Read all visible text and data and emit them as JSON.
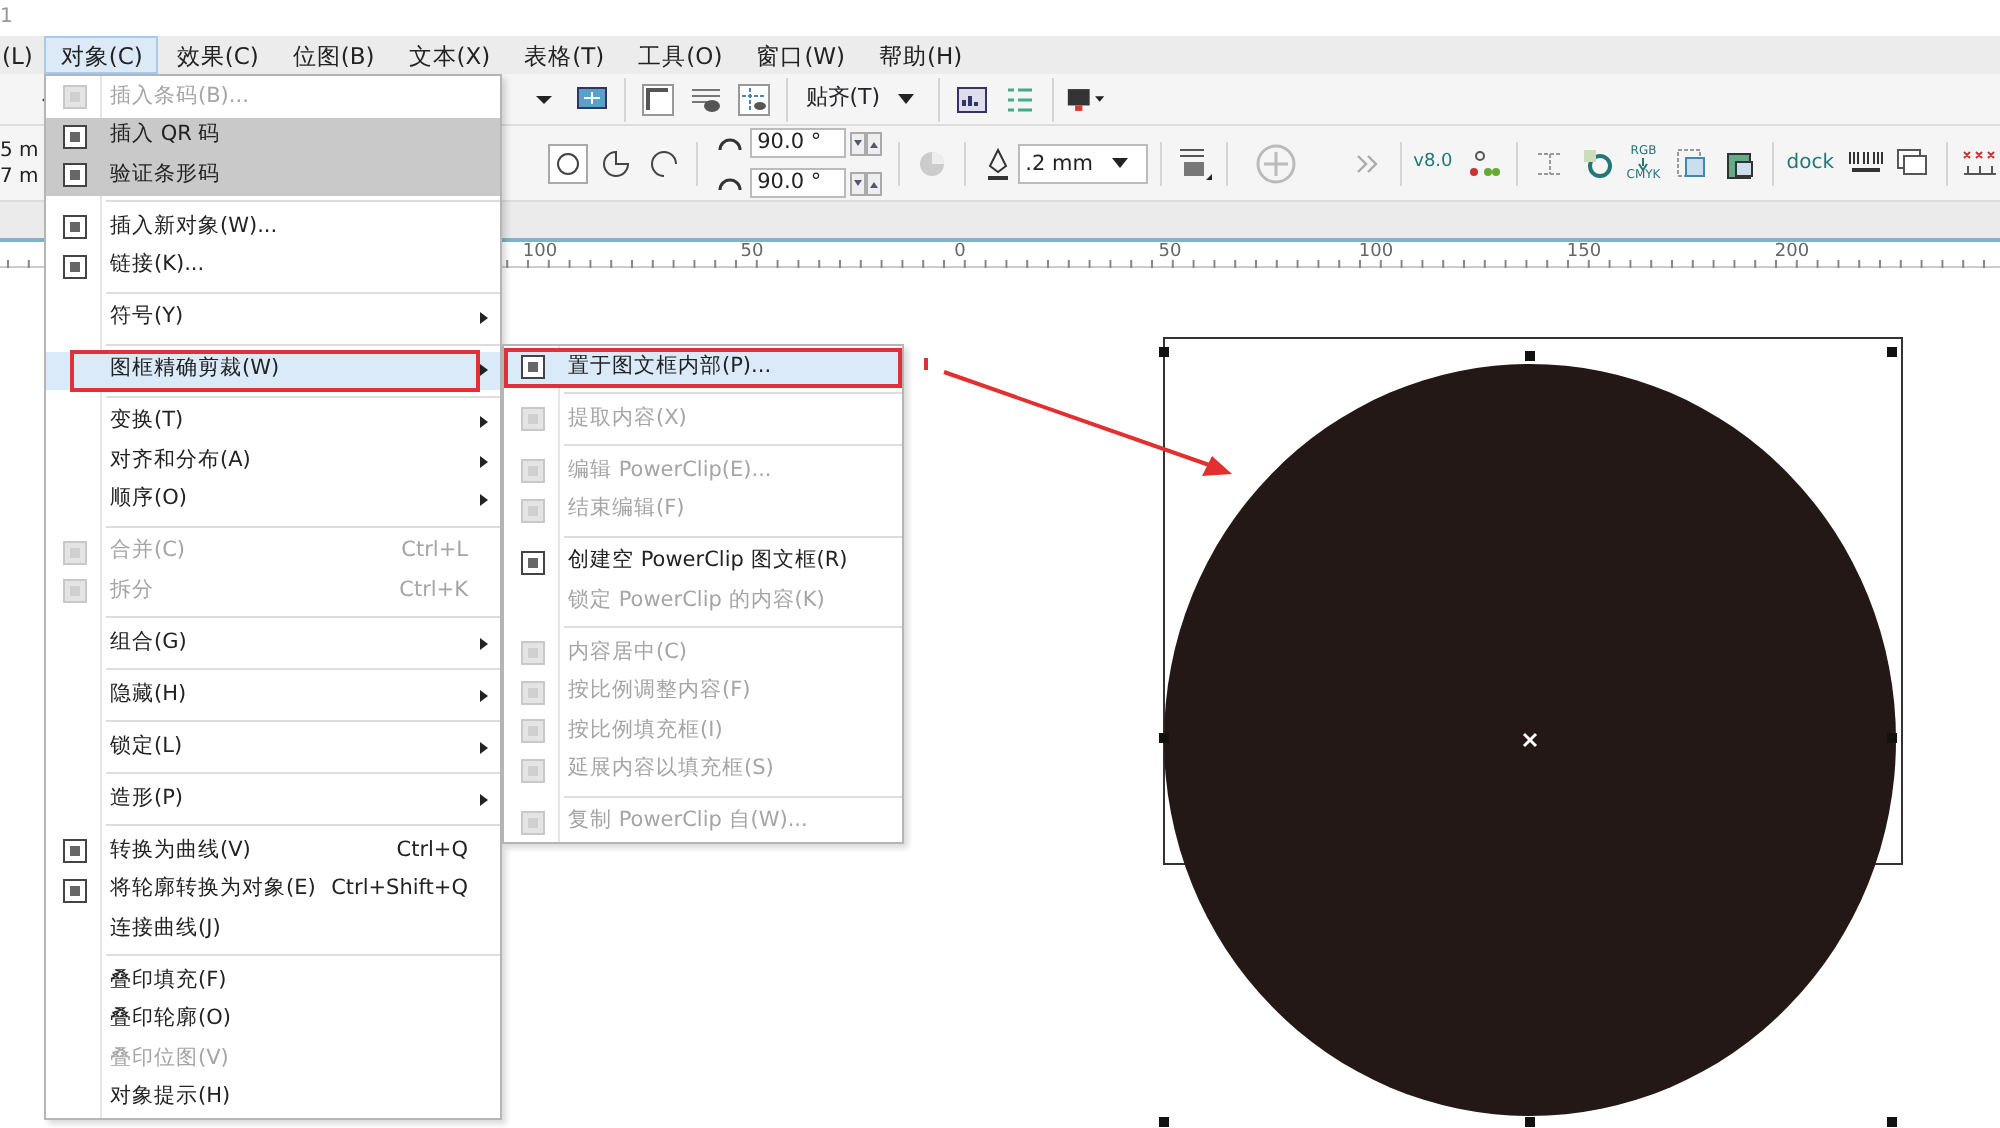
{
  "window": {
    "title": "1"
  },
  "menubar": [
    {
      "label": "(L)",
      "selected": false
    },
    {
      "label": "对象(C)",
      "selected": true
    },
    {
      "label": "效果(C)",
      "selected": false
    },
    {
      "label": "位图(B)",
      "selected": false
    },
    {
      "label": "文本(X)",
      "selected": false
    },
    {
      "label": "表格(T)",
      "selected": false
    },
    {
      "label": "工具(O)",
      "selected": false
    },
    {
      "label": "窗口(W)",
      "selected": false
    },
    {
      "label": "帮助(H)",
      "selected": false
    }
  ],
  "toolbar": {
    "snap_label": "贴齐(T)",
    "size_fields": [
      "5 m",
      "7 m"
    ],
    "angle_fields": [
      "90.0 °",
      "90.0 °"
    ],
    "outline_width": ".2 mm",
    "version_label": "v8.0",
    "rgb_label": "RGB",
    "cmyk_label": "CMYK",
    "dock_label": "dock"
  },
  "ruler": {
    "labels": [
      "100",
      "50",
      "0",
      "50",
      "100",
      "150",
      "200"
    ]
  },
  "menu": [
    {
      "kind": "item",
      "label": "插入条码(B)...",
      "icon": true,
      "disabled": true,
      "shaded": false,
      "selected": false,
      "submenu": false
    },
    {
      "kind": "item",
      "label": "插入 QR 码",
      "icon": true,
      "disabled": false,
      "shaded": true,
      "selected": false,
      "submenu": false
    },
    {
      "kind": "item",
      "label": "验证条形码",
      "icon": true,
      "disabled": false,
      "shaded": true,
      "selected": false,
      "submenu": false
    },
    {
      "kind": "separator"
    },
    {
      "kind": "item",
      "label": "插入新对象(W)...",
      "icon": true,
      "disabled": false,
      "shaded": false,
      "selected": false,
      "submenu": false
    },
    {
      "kind": "item",
      "label": "链接(K)...",
      "icon": true,
      "disabled": false,
      "shaded": false,
      "selected": false,
      "submenu": false
    },
    {
      "kind": "separator"
    },
    {
      "kind": "item",
      "label": "符号(Y)",
      "icon": false,
      "disabled": false,
      "shaded": false,
      "selected": false,
      "submenu": true
    },
    {
      "kind": "separator"
    },
    {
      "kind": "item",
      "label": "图框精确剪裁(W)",
      "icon": false,
      "disabled": false,
      "shaded": false,
      "selected": true,
      "submenu": true,
      "annotated": true
    },
    {
      "kind": "separator"
    },
    {
      "kind": "item",
      "label": "变换(T)",
      "icon": false,
      "disabled": false,
      "shaded": false,
      "selected": false,
      "submenu": true
    },
    {
      "kind": "item",
      "label": "对齐和分布(A)",
      "icon": false,
      "disabled": false,
      "shaded": false,
      "selected": false,
      "submenu": true
    },
    {
      "kind": "item",
      "label": "顺序(O)",
      "icon": false,
      "disabled": false,
      "shaded": false,
      "selected": false,
      "submenu": true
    },
    {
      "kind": "separator"
    },
    {
      "kind": "item",
      "label": "合并(C)",
      "shortcut": "Ctrl+L",
      "icon": true,
      "disabled": true,
      "shaded": false,
      "selected": false,
      "submenu": false
    },
    {
      "kind": "item",
      "label": "拆分",
      "shortcut": "Ctrl+K",
      "icon": true,
      "disabled": true,
      "shaded": false,
      "selected": false,
      "submenu": false
    },
    {
      "kind": "separator"
    },
    {
      "kind": "item",
      "label": "组合(G)",
      "icon": false,
      "disabled": false,
      "shaded": false,
      "selected": false,
      "submenu": true
    },
    {
      "kind": "separator"
    },
    {
      "kind": "item",
      "label": "隐藏(H)",
      "icon": false,
      "disabled": false,
      "shaded": false,
      "selected": false,
      "submenu": true
    },
    {
      "kind": "separator"
    },
    {
      "kind": "item",
      "label": "锁定(L)",
      "icon": false,
      "disabled": false,
      "shaded": false,
      "selected": false,
      "submenu": true
    },
    {
      "kind": "separator"
    },
    {
      "kind": "item",
      "label": "造形(P)",
      "icon": false,
      "disabled": false,
      "shaded": false,
      "selected": false,
      "submenu": true
    },
    {
      "kind": "separator"
    },
    {
      "kind": "item",
      "label": "转换为曲线(V)",
      "shortcut": "Ctrl+Q",
      "icon": true,
      "disabled": false,
      "shaded": false,
      "selected": false,
      "submenu": false
    },
    {
      "kind": "item",
      "label": "将轮廓转换为对象(E)",
      "shortcut": "Ctrl+Shift+Q",
      "icon": true,
      "disabled": false,
      "shaded": false,
      "selected": false,
      "submenu": false
    },
    {
      "kind": "item",
      "label": "连接曲线(J)",
      "icon": false,
      "disabled": false,
      "shaded": false,
      "selected": false,
      "submenu": false
    },
    {
      "kind": "separator"
    },
    {
      "kind": "item",
      "label": "叠印填充(F)",
      "icon": false,
      "disabled": false,
      "shaded": false,
      "selected": false,
      "submenu": false
    },
    {
      "kind": "item",
      "label": "叠印轮廓(O)",
      "icon": false,
      "disabled": false,
      "shaded": false,
      "selected": false,
      "submenu": false
    },
    {
      "kind": "item",
      "label": "叠印位图(V)",
      "icon": false,
      "disabled": true,
      "shaded": false,
      "selected": false,
      "submenu": false
    },
    {
      "kind": "item",
      "label": "对象提示(H)",
      "icon": false,
      "disabled": false,
      "shaded": false,
      "selected": false,
      "submenu": false
    }
  ],
  "submenu": [
    {
      "kind": "item",
      "label": "置于图文框内部(P)...",
      "icon": true,
      "disabled": false,
      "selected": true,
      "annotated": true
    },
    {
      "kind": "separator"
    },
    {
      "kind": "item",
      "label": "提取内容(X)",
      "icon": true,
      "disabled": true,
      "selected": false
    },
    {
      "kind": "separator"
    },
    {
      "kind": "item",
      "label": "编辑 PowerClip(E)...",
      "icon": true,
      "disabled": true,
      "selected": false
    },
    {
      "kind": "item",
      "label": "结束编辑(F)",
      "icon": true,
      "disabled": true,
      "selected": false
    },
    {
      "kind": "separator"
    },
    {
      "kind": "item",
      "label": "创建空 PowerClip 图文框(R)",
      "icon": true,
      "disabled": false,
      "selected": false
    },
    {
      "kind": "item",
      "label": "锁定 PowerClip 的内容(K)",
      "icon": false,
      "disabled": true,
      "selected": false
    },
    {
      "kind": "separator"
    },
    {
      "kind": "item",
      "label": "内容居中(C)",
      "icon": true,
      "disabled": true,
      "selected": false
    },
    {
      "kind": "item",
      "label": "按比例调整内容(F)",
      "icon": true,
      "disabled": true,
      "selected": false
    },
    {
      "kind": "item",
      "label": "按比例填充框(I)",
      "icon": true,
      "disabled": true,
      "selected": false
    },
    {
      "kind": "item",
      "label": "延展内容以填充框(S)",
      "icon": true,
      "disabled": true,
      "selected": false
    },
    {
      "kind": "separator"
    },
    {
      "kind": "item",
      "label": "复制 PowerClip 自(W)...",
      "icon": true,
      "disabled": true,
      "selected": false
    }
  ]
}
